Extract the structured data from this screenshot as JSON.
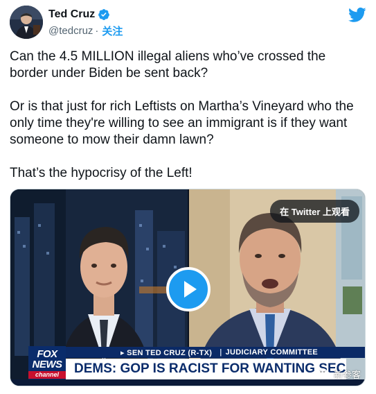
{
  "author": {
    "display_name": "Ted Cruz",
    "handle": "@tedcruz",
    "separator": "·",
    "follow_label": "关注",
    "avatar_icon": "avatar"
  },
  "icons": {
    "verified": "verified-badge-icon",
    "platform": "twitter-bird-icon",
    "play": "play-icon",
    "watermark": "wechat-icon"
  },
  "tweet": {
    "paragraphs": [
      "Can the 4.5 MILLION illegal aliens who’ve crossed the border under Biden be sent back?",
      "Or is that just for rich Leftists on Martha’s Vineyard who the only time they're willing to see an immigrant is if they want someone to mow their damn lawn?",
      "That’s the hypocrisy of the Left!"
    ]
  },
  "media": {
    "watch_on_twitter_label": "在 Twitter 上观看",
    "chyron_speaker": "▸ SEN TED CRUZ (R-TX)",
    "chyron_separator": "|",
    "chyron_committee": "JUDICIARY COMMITTEE",
    "headline": "DEMS: GOP IS RACIST FOR WANTING SECURE BORDER",
    "network_logo": {
      "line1": "FOX",
      "line2": "NEWS",
      "line3": "channel"
    }
  },
  "watermark": {
    "label": "新参客"
  },
  "colors": {
    "text_primary": "#0f1419",
    "text_secondary": "#536471",
    "accent": "#1d9bf0",
    "fox_navy": "#0a2c6b",
    "fox_red": "#c8102e"
  }
}
